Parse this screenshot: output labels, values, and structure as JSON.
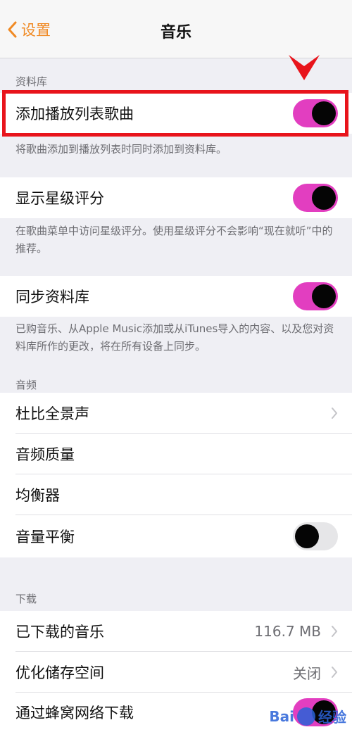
{
  "nav": {
    "back_label": "设置",
    "title": "音乐"
  },
  "library": {
    "header": "资料库",
    "add_playlist_songs": {
      "label": "添加播放列表歌曲",
      "on": true
    },
    "add_playlist_songs_footer": "将歌曲添加到播放列表时同时添加到资料库。",
    "show_star_ratings": {
      "label": "显示星级评分",
      "on": true
    },
    "show_star_ratings_footer": "在歌曲菜单中访问星级评分。使用星级评分不会影响“现在就听”中的推荐。",
    "sync_library": {
      "label": "同步资料库",
      "on": true
    },
    "sync_library_footer": "已购音乐、从Apple Music添加或从iTunes导入的内容、以及您对资料库所作的更改，将在所有设备上同步。"
  },
  "audio": {
    "header": "音频",
    "dolby": "杜比全景声",
    "quality": "音频质量",
    "eq": "均衡器",
    "sound_check": {
      "label": "音量平衡",
      "on": false
    }
  },
  "downloads": {
    "header": "下载",
    "downloaded_music": {
      "label": "已下载的音乐",
      "value": "116.7 MB"
    },
    "optimize_storage": {
      "label": "优化储存空间",
      "value": "关闭"
    },
    "cellular_download": {
      "label": "通过蜂窝网络下载",
      "on": true
    }
  },
  "watermark": {
    "text_left": "Bai",
    "text_right": "经验"
  },
  "colors": {
    "accent": "#f08a24",
    "toggle_on": "#e23ec0",
    "highlight": "#e8141b"
  }
}
